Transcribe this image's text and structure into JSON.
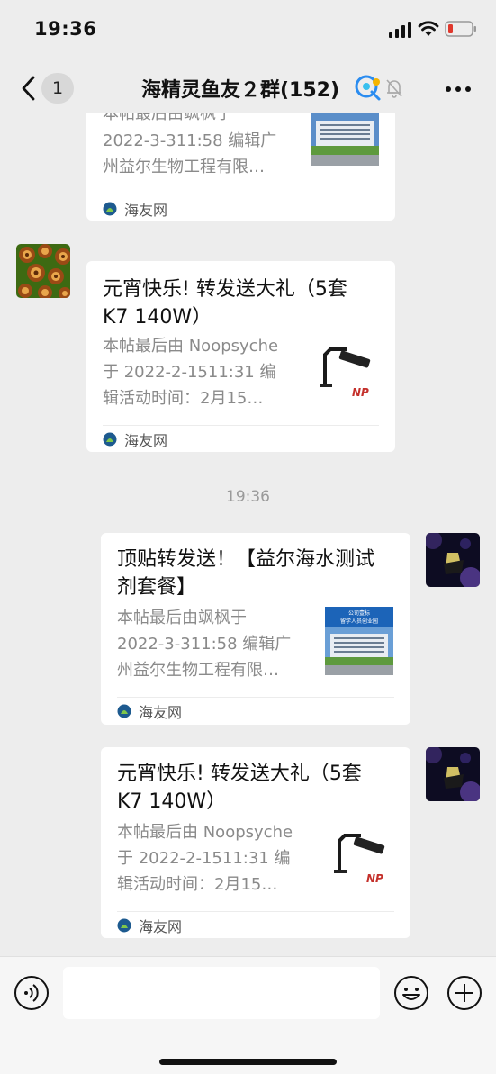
{
  "status_bar": {
    "time": "19:36"
  },
  "nav": {
    "unread_count": "1",
    "title": "海精灵鱼友２群(152)"
  },
  "messages": [
    {
      "side": "left",
      "title_partial": "本帖最后由飒枫于",
      "description": "2022-3-311:58 编辑广\n州益尔生物工程有限…",
      "source": "海友网"
    },
    {
      "side": "left",
      "title": "元宵快乐! 转发送大礼（5套 K7  140W）",
      "description": "本帖最后由 Noopsyche\n于 2022-2-1511:31 编\n辑活动时间：2月15…",
      "source": "海友网"
    },
    {
      "side": "right",
      "title": "顶贴转发送！【益尔海水测试剂套餐】",
      "description": "本帖最后由飒枫于\n2022-3-311:58 编辑广\n州益尔生物工程有限…",
      "source": "海友网"
    },
    {
      "side": "right",
      "title": "元宵快乐! 转发送大礼（5套 K7  140W）",
      "description": "本帖最后由 Noopsyche\n于 2022-2-1511:31 编\n辑活动时间：2月15…",
      "source": "海友网"
    }
  ],
  "timestamp": "19:36",
  "thumb_texts": {
    "building_sign_1": "公司壹标",
    "building_sign_2": "留学人员创业园",
    "lamp_brand": "NP"
  },
  "input": {
    "placeholder": ""
  }
}
